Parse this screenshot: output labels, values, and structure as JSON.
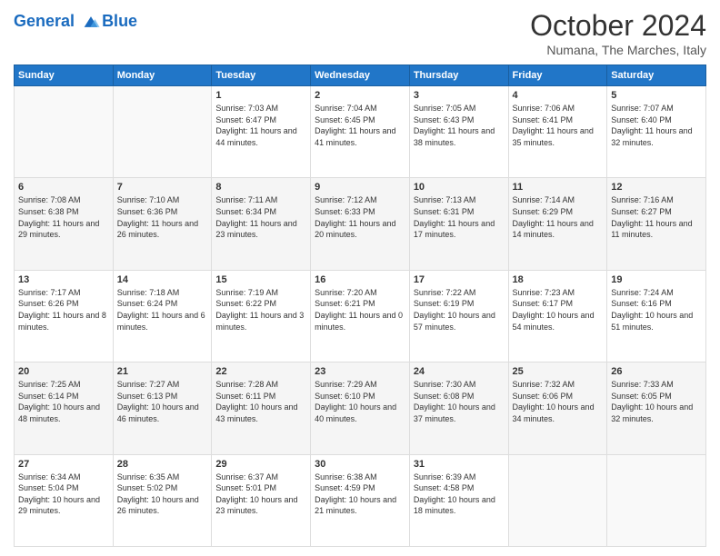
{
  "header": {
    "logo_text1": "General",
    "logo_text2": "Blue",
    "month_year": "October 2024",
    "location": "Numana, The Marches, Italy"
  },
  "weekdays": [
    "Sunday",
    "Monday",
    "Tuesday",
    "Wednesday",
    "Thursday",
    "Friday",
    "Saturday"
  ],
  "weeks": [
    [
      {
        "day": "",
        "info": ""
      },
      {
        "day": "",
        "info": ""
      },
      {
        "day": "1",
        "info": "Sunrise: 7:03 AM\nSunset: 6:47 PM\nDaylight: 11 hours and 44 minutes."
      },
      {
        "day": "2",
        "info": "Sunrise: 7:04 AM\nSunset: 6:45 PM\nDaylight: 11 hours and 41 minutes."
      },
      {
        "day": "3",
        "info": "Sunrise: 7:05 AM\nSunset: 6:43 PM\nDaylight: 11 hours and 38 minutes."
      },
      {
        "day": "4",
        "info": "Sunrise: 7:06 AM\nSunset: 6:41 PM\nDaylight: 11 hours and 35 minutes."
      },
      {
        "day": "5",
        "info": "Sunrise: 7:07 AM\nSunset: 6:40 PM\nDaylight: 11 hours and 32 minutes."
      }
    ],
    [
      {
        "day": "6",
        "info": "Sunrise: 7:08 AM\nSunset: 6:38 PM\nDaylight: 11 hours and 29 minutes."
      },
      {
        "day": "7",
        "info": "Sunrise: 7:10 AM\nSunset: 6:36 PM\nDaylight: 11 hours and 26 minutes."
      },
      {
        "day": "8",
        "info": "Sunrise: 7:11 AM\nSunset: 6:34 PM\nDaylight: 11 hours and 23 minutes."
      },
      {
        "day": "9",
        "info": "Sunrise: 7:12 AM\nSunset: 6:33 PM\nDaylight: 11 hours and 20 minutes."
      },
      {
        "day": "10",
        "info": "Sunrise: 7:13 AM\nSunset: 6:31 PM\nDaylight: 11 hours and 17 minutes."
      },
      {
        "day": "11",
        "info": "Sunrise: 7:14 AM\nSunset: 6:29 PM\nDaylight: 11 hours and 14 minutes."
      },
      {
        "day": "12",
        "info": "Sunrise: 7:16 AM\nSunset: 6:27 PM\nDaylight: 11 hours and 11 minutes."
      }
    ],
    [
      {
        "day": "13",
        "info": "Sunrise: 7:17 AM\nSunset: 6:26 PM\nDaylight: 11 hours and 8 minutes."
      },
      {
        "day": "14",
        "info": "Sunrise: 7:18 AM\nSunset: 6:24 PM\nDaylight: 11 hours and 6 minutes."
      },
      {
        "day": "15",
        "info": "Sunrise: 7:19 AM\nSunset: 6:22 PM\nDaylight: 11 hours and 3 minutes."
      },
      {
        "day": "16",
        "info": "Sunrise: 7:20 AM\nSunset: 6:21 PM\nDaylight: 11 hours and 0 minutes."
      },
      {
        "day": "17",
        "info": "Sunrise: 7:22 AM\nSunset: 6:19 PM\nDaylight: 10 hours and 57 minutes."
      },
      {
        "day": "18",
        "info": "Sunrise: 7:23 AM\nSunset: 6:17 PM\nDaylight: 10 hours and 54 minutes."
      },
      {
        "day": "19",
        "info": "Sunrise: 7:24 AM\nSunset: 6:16 PM\nDaylight: 10 hours and 51 minutes."
      }
    ],
    [
      {
        "day": "20",
        "info": "Sunrise: 7:25 AM\nSunset: 6:14 PM\nDaylight: 10 hours and 48 minutes."
      },
      {
        "day": "21",
        "info": "Sunrise: 7:27 AM\nSunset: 6:13 PM\nDaylight: 10 hours and 46 minutes."
      },
      {
        "day": "22",
        "info": "Sunrise: 7:28 AM\nSunset: 6:11 PM\nDaylight: 10 hours and 43 minutes."
      },
      {
        "day": "23",
        "info": "Sunrise: 7:29 AM\nSunset: 6:10 PM\nDaylight: 10 hours and 40 minutes."
      },
      {
        "day": "24",
        "info": "Sunrise: 7:30 AM\nSunset: 6:08 PM\nDaylight: 10 hours and 37 minutes."
      },
      {
        "day": "25",
        "info": "Sunrise: 7:32 AM\nSunset: 6:06 PM\nDaylight: 10 hours and 34 minutes."
      },
      {
        "day": "26",
        "info": "Sunrise: 7:33 AM\nSunset: 6:05 PM\nDaylight: 10 hours and 32 minutes."
      }
    ],
    [
      {
        "day": "27",
        "info": "Sunrise: 6:34 AM\nSunset: 5:04 PM\nDaylight: 10 hours and 29 minutes."
      },
      {
        "day": "28",
        "info": "Sunrise: 6:35 AM\nSunset: 5:02 PM\nDaylight: 10 hours and 26 minutes."
      },
      {
        "day": "29",
        "info": "Sunrise: 6:37 AM\nSunset: 5:01 PM\nDaylight: 10 hours and 23 minutes."
      },
      {
        "day": "30",
        "info": "Sunrise: 6:38 AM\nSunset: 4:59 PM\nDaylight: 10 hours and 21 minutes."
      },
      {
        "day": "31",
        "info": "Sunrise: 6:39 AM\nSunset: 4:58 PM\nDaylight: 10 hours and 18 minutes."
      },
      {
        "day": "",
        "info": ""
      },
      {
        "day": "",
        "info": ""
      }
    ]
  ]
}
